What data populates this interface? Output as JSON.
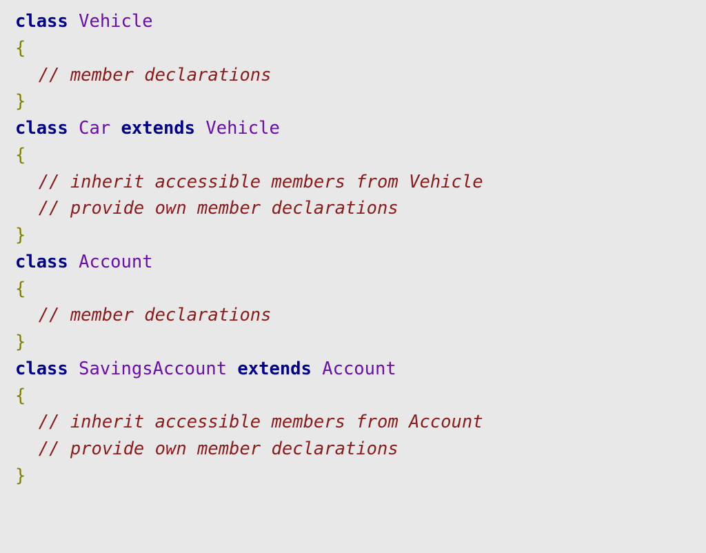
{
  "code": {
    "lines": [
      {
        "tokens": [
          {
            "cls": "kw",
            "t": "class"
          },
          {
            "cls": "",
            "t": " "
          },
          {
            "cls": "type",
            "t": "Vehicle"
          }
        ]
      },
      {
        "tokens": [
          {
            "cls": "brace",
            "t": "{"
          }
        ]
      },
      {
        "tokens": [
          {
            "cls": "indent",
            "t": ""
          },
          {
            "cls": "comment",
            "t": "// member declarations"
          }
        ]
      },
      {
        "tokens": [
          {
            "cls": "brace",
            "t": "}"
          }
        ]
      },
      {
        "tokens": [
          {
            "cls": "kw",
            "t": "class"
          },
          {
            "cls": "",
            "t": " "
          },
          {
            "cls": "type",
            "t": "Car"
          },
          {
            "cls": "",
            "t": " "
          },
          {
            "cls": "kw",
            "t": "extends"
          },
          {
            "cls": "",
            "t": " "
          },
          {
            "cls": "type",
            "t": "Vehicle"
          }
        ]
      },
      {
        "tokens": [
          {
            "cls": "brace",
            "t": "{"
          }
        ]
      },
      {
        "tokens": [
          {
            "cls": "indent",
            "t": ""
          },
          {
            "cls": "comment",
            "t": "// inherit accessible members from Vehicle"
          }
        ]
      },
      {
        "tokens": [
          {
            "cls": "indent",
            "t": ""
          },
          {
            "cls": "comment",
            "t": "// provide own member declarations"
          }
        ]
      },
      {
        "tokens": [
          {
            "cls": "brace",
            "t": "}"
          }
        ]
      },
      {
        "tokens": [
          {
            "cls": "kw",
            "t": "class"
          },
          {
            "cls": "",
            "t": " "
          },
          {
            "cls": "type",
            "t": "Account"
          }
        ]
      },
      {
        "tokens": [
          {
            "cls": "brace",
            "t": "{"
          }
        ]
      },
      {
        "tokens": [
          {
            "cls": "indent",
            "t": ""
          },
          {
            "cls": "comment",
            "t": "// member declarations"
          }
        ]
      },
      {
        "tokens": [
          {
            "cls": "brace",
            "t": "}"
          }
        ]
      },
      {
        "tokens": [
          {
            "cls": "kw",
            "t": "class"
          },
          {
            "cls": "",
            "t": " "
          },
          {
            "cls": "type",
            "t": "SavingsAccount"
          },
          {
            "cls": "",
            "t": " "
          },
          {
            "cls": "kw",
            "t": "extends"
          },
          {
            "cls": "",
            "t": " "
          },
          {
            "cls": "type",
            "t": "Account"
          }
        ]
      },
      {
        "tokens": [
          {
            "cls": "brace",
            "t": "{"
          }
        ]
      },
      {
        "tokens": [
          {
            "cls": "indent",
            "t": ""
          },
          {
            "cls": "comment",
            "t": "// inherit accessible members from Account"
          }
        ]
      },
      {
        "tokens": [
          {
            "cls": "indent",
            "t": ""
          },
          {
            "cls": "comment",
            "t": "// provide own member declarations"
          }
        ]
      },
      {
        "tokens": [
          {
            "cls": "brace",
            "t": "}"
          }
        ]
      }
    ]
  }
}
